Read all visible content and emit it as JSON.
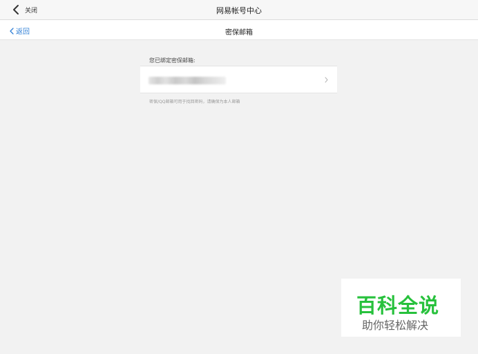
{
  "topbar": {
    "close_label": "关闭",
    "app_title": "网易帐号中心",
    "icons": {
      "close": "chevron-left-icon"
    }
  },
  "navbar": {
    "back_label": "返回",
    "page_title": "密保邮箱",
    "icons": {
      "back": "chevron-left-icon"
    }
  },
  "main": {
    "section_label": "您已绑定密保邮箱:",
    "email_value": "",
    "email_blurred": true,
    "hint": "密保/QQ邮箱可用于找回密码，请确保为本人邮箱",
    "icons": {
      "row": "chevron-right-icon"
    }
  },
  "watermark": {
    "title": "百科全说",
    "subtitle": "助你轻松解决"
  },
  "colors": {
    "background": "#f2f2f2",
    "link": "#2f7fd6",
    "watermark_green": "#27c13c"
  }
}
